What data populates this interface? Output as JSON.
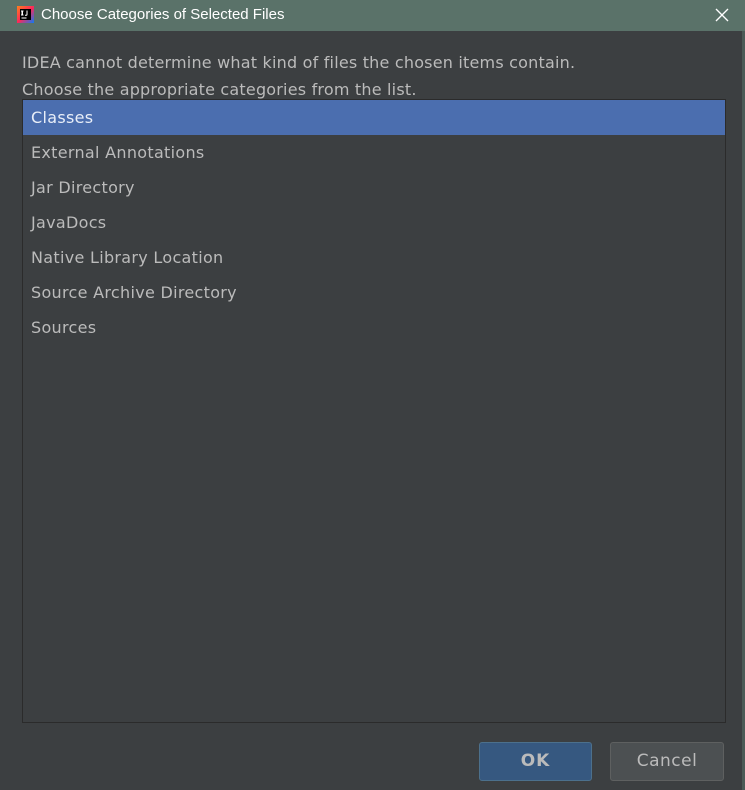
{
  "window": {
    "title": "Choose Categories of Selected Files",
    "app_icon": "intellij-idea-icon",
    "close_icon": "close-icon"
  },
  "message": {
    "line1": "IDEA cannot determine what kind of files the chosen items contain.",
    "line2": "Choose the appropriate categories from the list."
  },
  "categories": {
    "selected_index": 0,
    "items": [
      {
        "label": "Classes",
        "selected": true
      },
      {
        "label": "External Annotations",
        "selected": false
      },
      {
        "label": "Jar Directory",
        "selected": false
      },
      {
        "label": "JavaDocs",
        "selected": false
      },
      {
        "label": "Native Library Location",
        "selected": false
      },
      {
        "label": "Source Archive Directory",
        "selected": false
      },
      {
        "label": "Sources",
        "selected": false
      }
    ]
  },
  "buttons": {
    "ok_label": "OK",
    "cancel_label": "Cancel"
  },
  "colors": {
    "titlebar": "#5a7269",
    "background": "#3c3f41",
    "selection": "#4b6eaf",
    "default_button": "#365880",
    "text": "#bbbbbb"
  }
}
